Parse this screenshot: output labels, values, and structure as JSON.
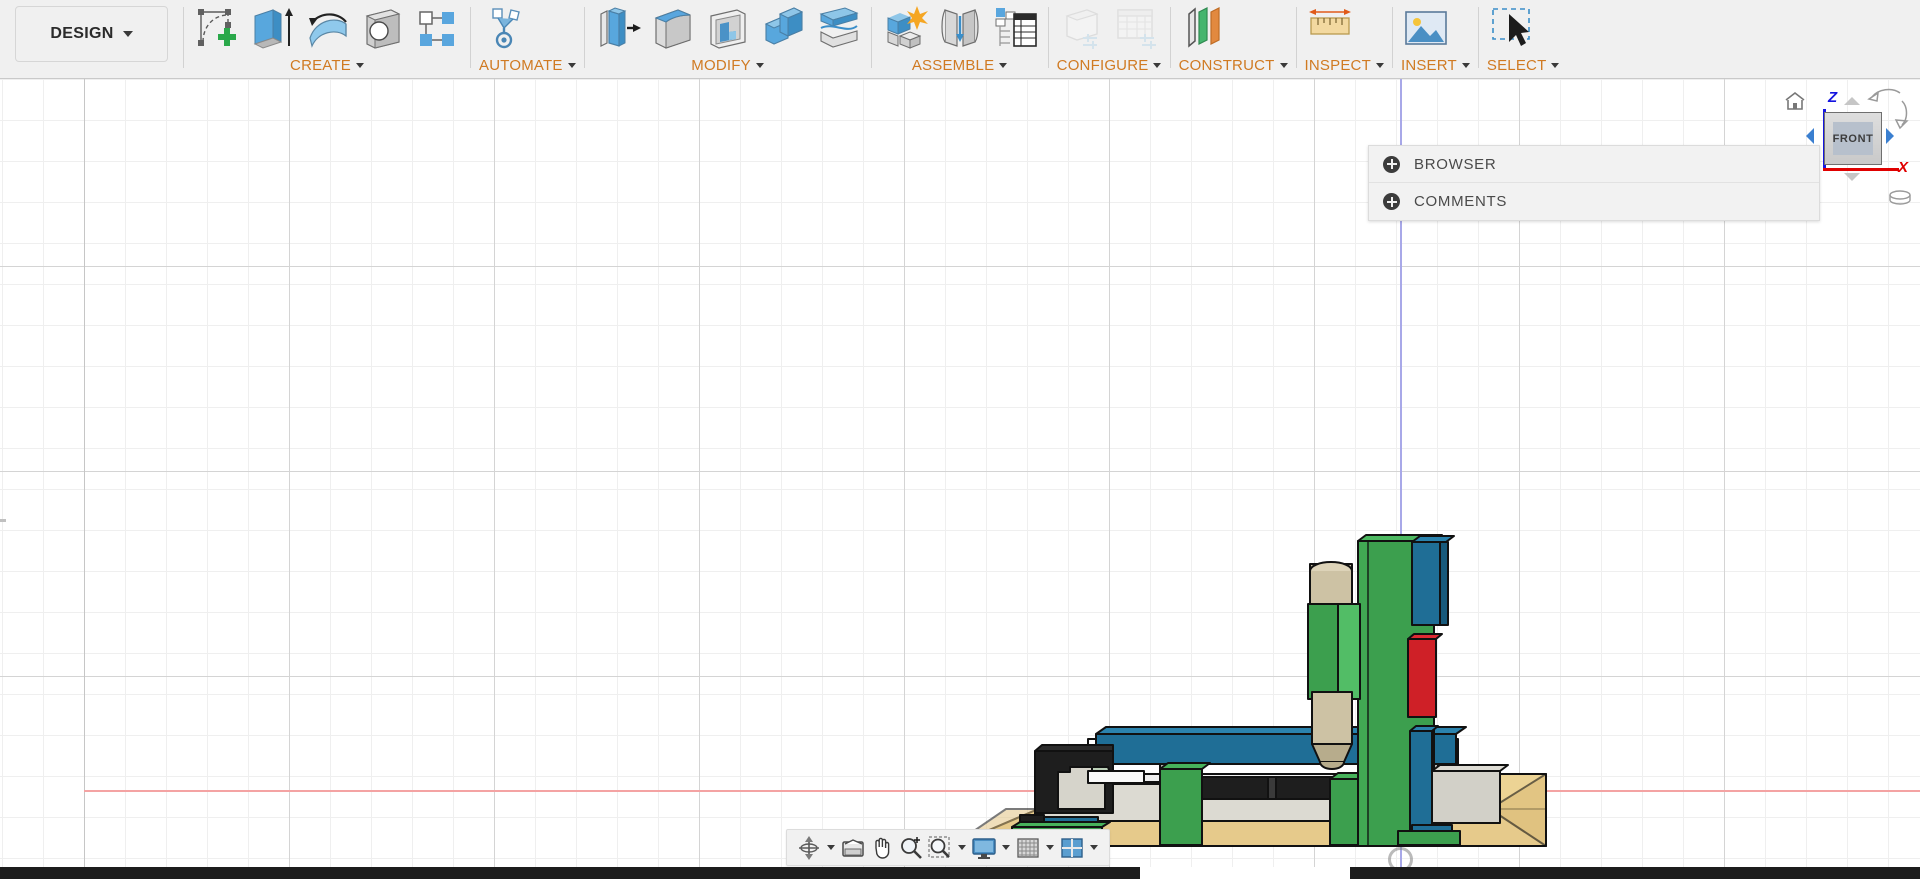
{
  "app": {
    "workspace_label": "DESIGN",
    "workspace_icon": "chevron-down-icon"
  },
  "toolbar": {
    "panels": [
      {
        "id": "create",
        "label": "CREATE",
        "icons": [
          {
            "name": "create-sketch-icon",
            "enabled": true
          },
          {
            "name": "extrude-icon",
            "enabled": true
          },
          {
            "name": "revolve-icon",
            "enabled": true
          },
          {
            "name": "hole-icon",
            "enabled": true
          },
          {
            "name": "pattern-icon",
            "enabled": true
          }
        ]
      },
      {
        "id": "automate",
        "label": "AUTOMATE",
        "icons": [
          {
            "name": "automate-assembly-icon",
            "enabled": true
          }
        ]
      },
      {
        "id": "modify",
        "label": "MODIFY",
        "icons": [
          {
            "name": "press-pull-icon",
            "enabled": true
          },
          {
            "name": "fillet-icon",
            "enabled": true
          },
          {
            "name": "shell-icon",
            "enabled": true
          },
          {
            "name": "combine-icon",
            "enabled": true
          },
          {
            "name": "split-face-icon",
            "enabled": true
          }
        ]
      },
      {
        "id": "assemble",
        "label": "ASSEMBLE",
        "icons": [
          {
            "name": "new-component-icon",
            "enabled": true
          },
          {
            "name": "joint-icon",
            "enabled": true
          },
          {
            "name": "bill-of-materials-icon",
            "enabled": true
          }
        ]
      },
      {
        "id": "configure",
        "label": "CONFIGURE",
        "icons": [
          {
            "name": "create-configuration-icon",
            "enabled": false
          },
          {
            "name": "configuration-table-icon",
            "enabled": false
          }
        ]
      },
      {
        "id": "construct",
        "label": "CONSTRUCT",
        "icons": [
          {
            "name": "offset-plane-icon",
            "enabled": true
          }
        ]
      },
      {
        "id": "inspect",
        "label": "INSPECT",
        "icons": [
          {
            "name": "measure-icon",
            "enabled": true
          }
        ]
      },
      {
        "id": "insert",
        "label": "INSERT",
        "icons": [
          {
            "name": "insert-mcmaster-icon",
            "enabled": true
          }
        ]
      },
      {
        "id": "select",
        "label": "SELECT",
        "icons": [
          {
            "name": "select-cursor-icon",
            "enabled": true
          }
        ]
      }
    ]
  },
  "side_panels": {
    "browser": {
      "label": "BROWSER",
      "expand_icon": "plus-circle-icon"
    },
    "comments": {
      "label": "COMMENTS",
      "expand_icon": "plus-circle-icon"
    }
  },
  "viewcube": {
    "face_label": "FRONT",
    "axis_z_label": "Z",
    "axis_x_label": "X",
    "axis_z_color": "#1414e0",
    "axis_x_color": "#e00000",
    "home_icon": "home-icon",
    "orbit_icon": "orbit-arrows-icon"
  },
  "navbar": {
    "items": [
      {
        "name": "orbit-icon",
        "has_caret": true
      },
      {
        "name": "look-at-icon",
        "has_caret": false
      },
      {
        "name": "pan-hand-icon",
        "has_caret": false
      },
      {
        "name": "zoom-magnifier-icon",
        "has_caret": false
      },
      {
        "name": "zoom-window-icon",
        "has_caret": true
      },
      {
        "name": "display-settings-icon",
        "has_caret": true
      },
      {
        "name": "grid-snaps-icon",
        "has_caret": true
      },
      {
        "name": "viewports-icon",
        "has_caret": true
      }
    ]
  },
  "canvas": {
    "view_orientation": "FRONT",
    "grid_visible": true,
    "x_axis_color": "#f4a3a3",
    "z_axis_color": "#a8a8e8",
    "model_colors": {
      "frame_green": "#3c9f4e",
      "table_blue": "#1f6e96",
      "accent_red": "#cf2027",
      "base_tan": "#e8cd8e",
      "body_grey": "#dcdad2",
      "dark_body": "#1e1e1e",
      "spindle_beige": "#cdc2a4"
    }
  }
}
